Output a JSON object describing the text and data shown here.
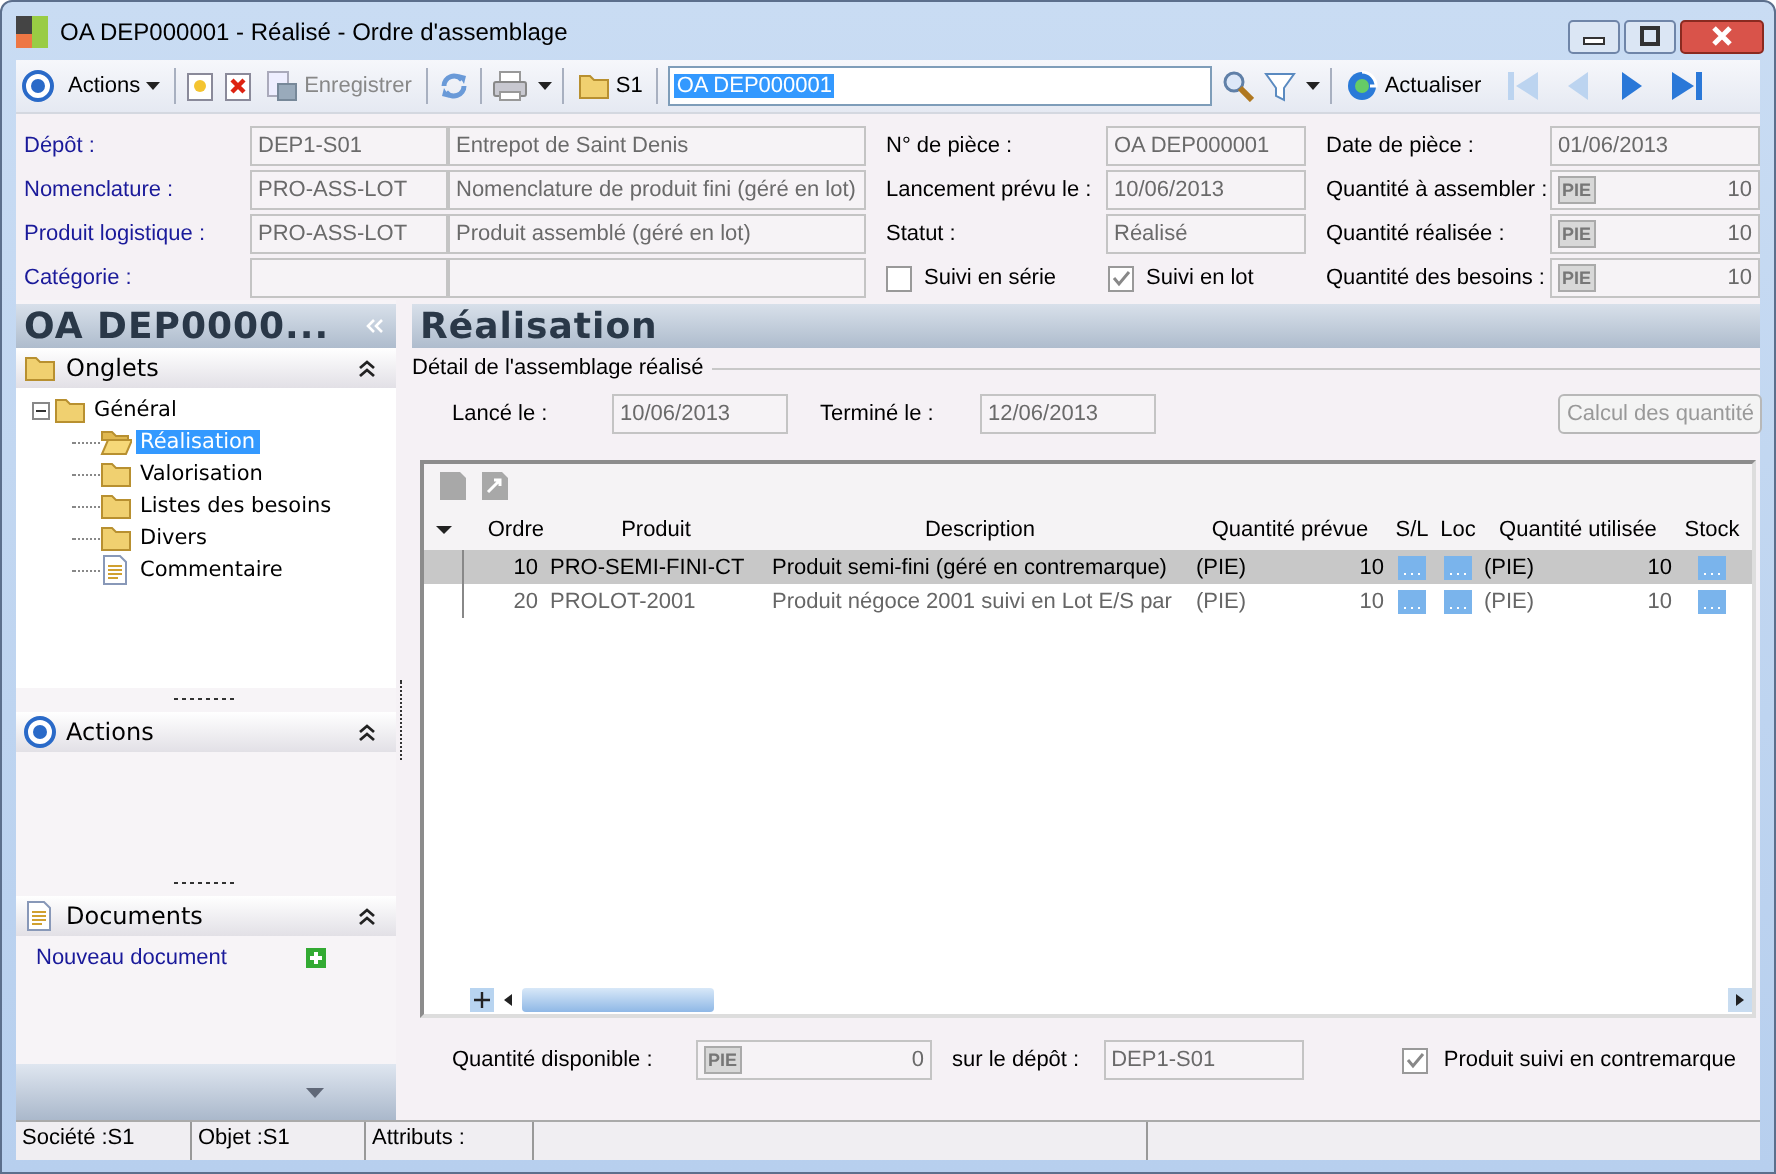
{
  "window": {
    "title": "OA DEP000001 - Réalisé -  Ordre d'assemblage"
  },
  "toolbar": {
    "actions_menu": "Actions",
    "save": {
      "label": "Enregistrer",
      "disabled": true
    },
    "site": "S1",
    "search": {
      "value": "OA DEP000001"
    },
    "refresh": "Actualiser",
    "navigation": [
      {
        "kind": "first",
        "disabled": true
      },
      {
        "kind": "previous",
        "disabled": true
      },
      {
        "kind": "next",
        "disabled": false
      },
      {
        "kind": "last",
        "disabled": false
      }
    ]
  },
  "header": {
    "left": [
      {
        "label": "Dépôt :",
        "code": "DEP1-S01",
        "description": "Entrepot de  Saint  Denis"
      },
      {
        "label": "Nomenclature :",
        "code": "PRO-ASS-LOT",
        "description": "Nomenclature de produit fini (géré en lot)"
      },
      {
        "label": "Produit logistique :",
        "code": "PRO-ASS-LOT",
        "description": "Produit assemblé (géré en lot)"
      },
      {
        "label": "Catégorie :"
      }
    ],
    "middle": [
      {
        "label": "N° de pièce :",
        "value": "OA DEP000001"
      },
      {
        "label": "Lancement prévu le :",
        "value": "10/06/2013"
      },
      {
        "label": "Statut :",
        "value": "Réalisé"
      }
    ],
    "checkboxes": [
      {
        "label": "Suivi en série",
        "checked": false
      },
      {
        "label": "Suivi en lot",
        "checked": true
      }
    ],
    "right": [
      {
        "label": "Date de pièce :",
        "value": "01/06/2013"
      },
      {
        "label": "Quantité à assembler :",
        "unit": "PIE",
        "value": "10"
      },
      {
        "label": "Quantité réalisée :",
        "unit": "PIE",
        "value": "10"
      },
      {
        "label": "Quantité des besoins :",
        "unit": "PIE",
        "value": "10"
      }
    ]
  },
  "sidebar": {
    "title": "OA DEP0000...",
    "panels": [
      {
        "kind": "tree",
        "title": "Onglets",
        "items": [
          {
            "label": "Général",
            "kind": "folder",
            "expanded": true,
            "selected": false,
            "children": [
              {
                "label": "Réalisation",
                "kind": "folder",
                "selected": true
              },
              {
                "label": "Valorisation",
                "kind": "folder",
                "selected": false
              },
              {
                "label": "Listes des besoins",
                "kind": "folder",
                "selected": false
              },
              {
                "label": "Divers",
                "kind": "folder",
                "selected": false
              },
              {
                "label": "Commentaire",
                "kind": "document",
                "selected": false
              }
            ]
          }
        ]
      },
      {
        "kind": "actions",
        "title": "Actions"
      },
      {
        "kind": "documents",
        "title": "Documents",
        "links": [
          "Nouveau document"
        ]
      }
    ]
  },
  "main": {
    "title": "Réalisation",
    "group": "Détail de l'assemblage réalisé",
    "dates": [
      {
        "label": "Lancé le :",
        "value": "10/06/2013"
      },
      {
        "label": "Terminé le :",
        "value": "12/06/2013"
      }
    ],
    "compute_button": {
      "label": "Calcul des quantité",
      "disabled": true
    },
    "table": {
      "columns": [
        "Ordre",
        "Produit",
        "Description",
        "Quantité prévue",
        "S/L",
        "Loc",
        "Quantité utilisée",
        "Stock"
      ],
      "rows": [
        {
          "selected": true,
          "order": "10",
          "product": "PRO-SEMI-FINI-CT",
          "description": "Produit semi-fini (géré en contremarque)",
          "planned_unit": "(PIE)",
          "planned": "10",
          "used_unit": "(PIE)",
          "used": "10"
        },
        {
          "selected": false,
          "order": "20",
          "product": "PROLOT-2001",
          "description": "Produit négoce 2001 suivi en Lot E/S par",
          "planned_unit": "(PIE)",
          "planned": "10",
          "used_unit": "(PIE)",
          "used": "10"
        }
      ]
    },
    "available": {
      "label": "Quantité disponible :",
      "unit": "PIE",
      "value": "0",
      "depot_label": "sur le dépôt :",
      "depot": "DEP1-S01"
    },
    "counter_mark": {
      "label": "Produit suivi en contremarque",
      "checked": true
    }
  },
  "status_bar": [
    "Société :S1",
    "Objet :S1",
    "Attributs :"
  ]
}
